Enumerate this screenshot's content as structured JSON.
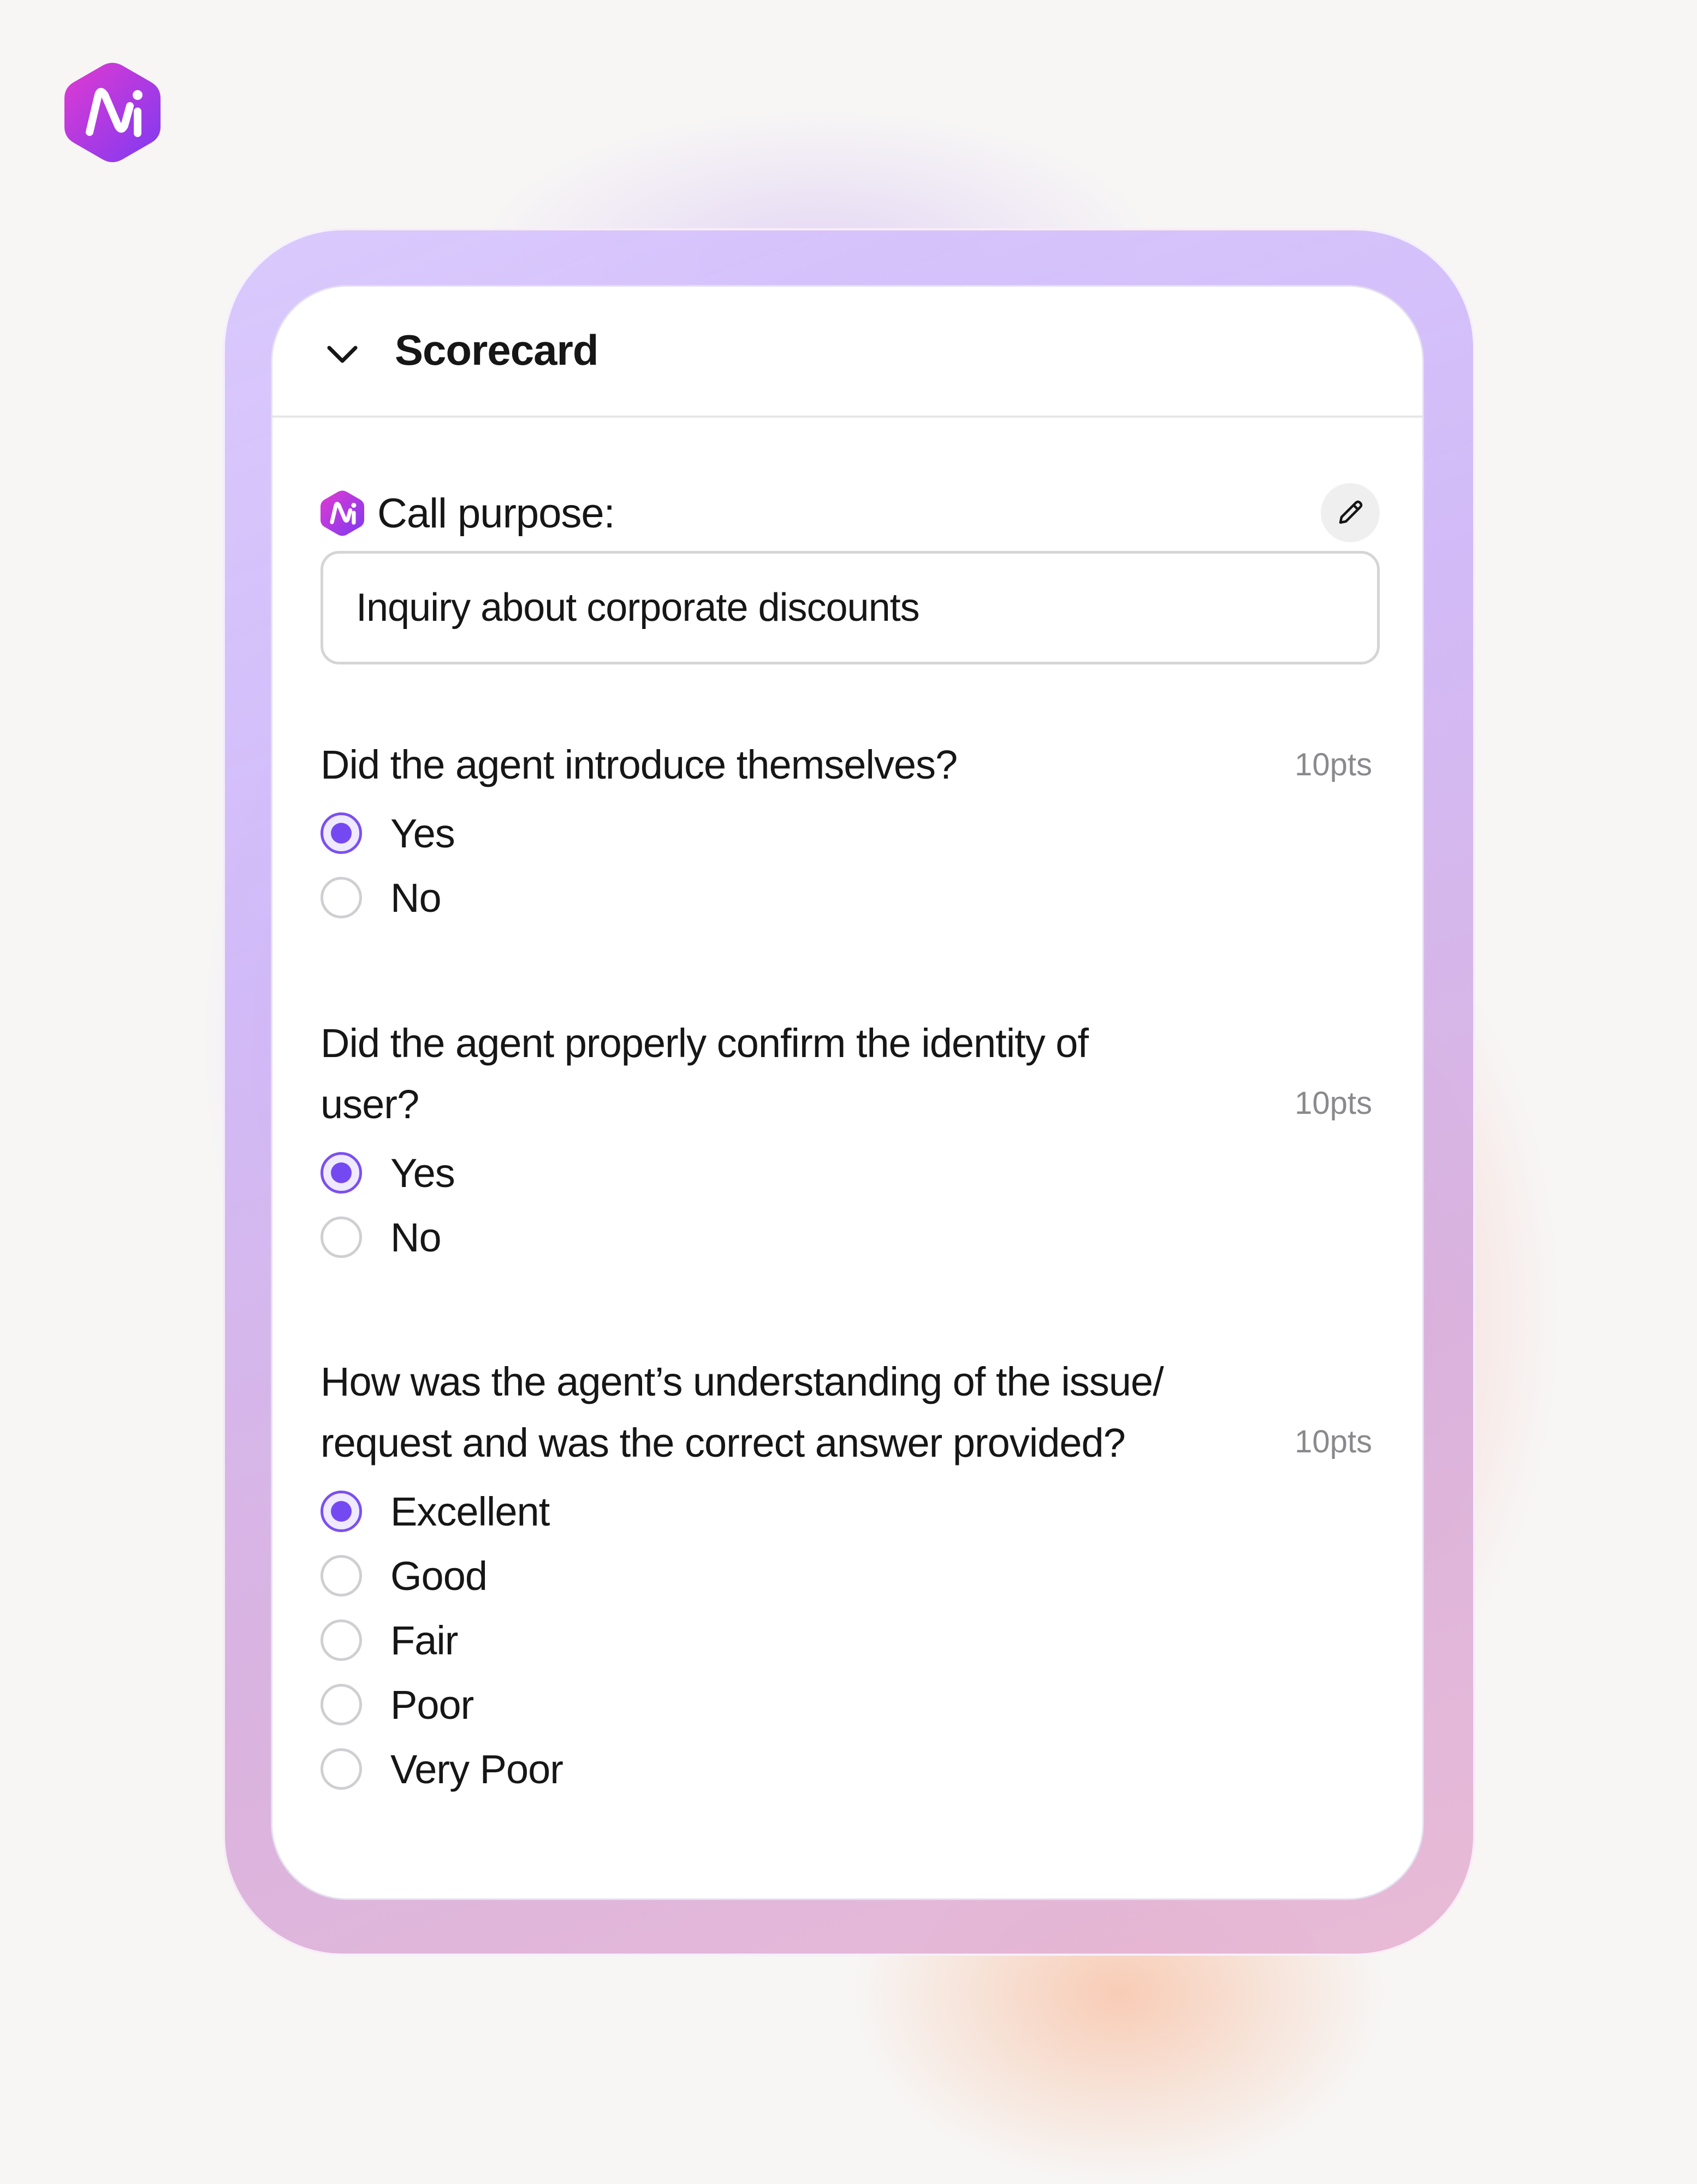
{
  "brand": {
    "logo_icon": "brand-ni-logo-icon",
    "accent": "#7549f2",
    "logo_gradient": [
      "#e13ad1",
      "#7e3af2"
    ]
  },
  "scorecard": {
    "title": "Scorecard",
    "collapse_icon": "chevron-down-icon",
    "purpose": {
      "label": "Call purpose:",
      "value": "Inquiry about corporate discounts",
      "edit_icon": "pencil-icon"
    },
    "questions": [
      {
        "text": "Did the agent introduce themselves?",
        "points": "10pts",
        "options": [
          {
            "label": "Yes",
            "selected": true
          },
          {
            "label": "No",
            "selected": false
          }
        ]
      },
      {
        "text_line1": "Did the agent properly confirm the identity of",
        "text_line2": "user?",
        "points": "10pts",
        "options": [
          {
            "label": "Yes",
            "selected": true
          },
          {
            "label": "No",
            "selected": false
          }
        ]
      },
      {
        "text_line1": "How was the agent’s understanding of the issue/",
        "text_line2": "request and was the correct answer provided?",
        "points": "10pts",
        "options": [
          {
            "label": "Excellent",
            "selected": true
          },
          {
            "label": "Good",
            "selected": false
          },
          {
            "label": "Fair",
            "selected": false
          },
          {
            "label": "Poor",
            "selected": false
          },
          {
            "label": "Very Poor",
            "selected": false
          }
        ]
      }
    ]
  }
}
